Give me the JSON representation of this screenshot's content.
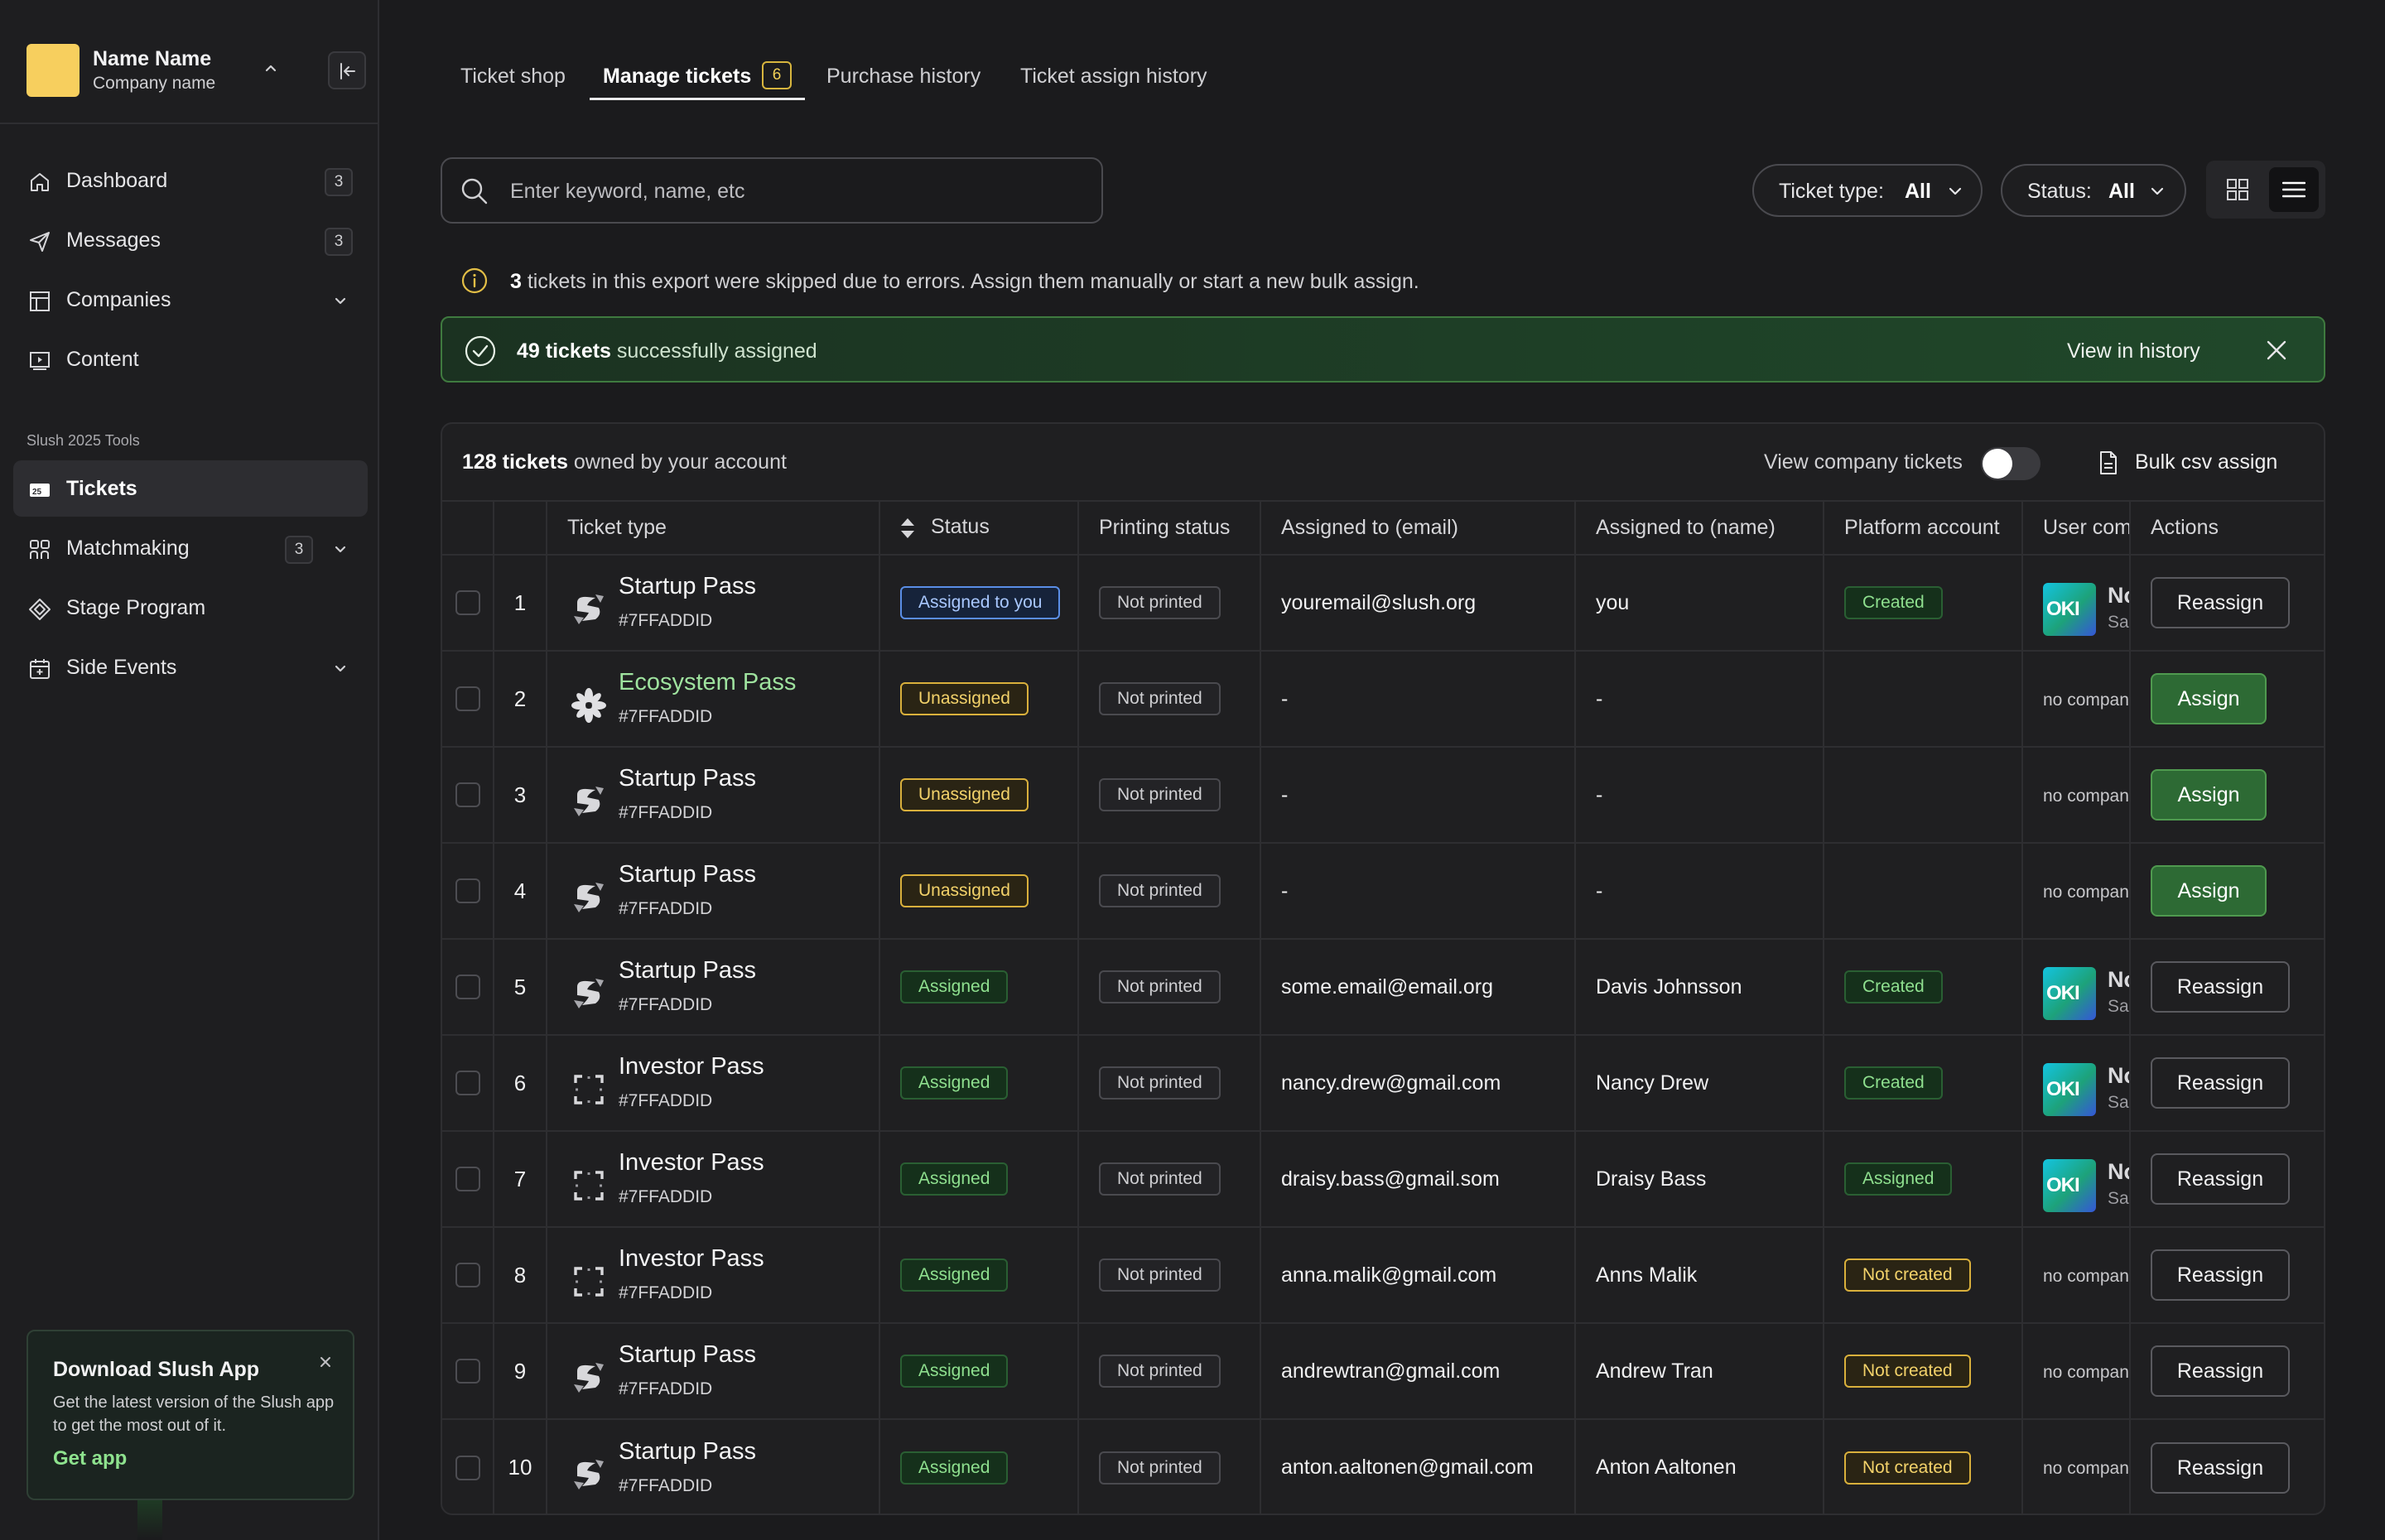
{
  "profile": {
    "name": "Name Name",
    "company": "Company name"
  },
  "nav": [
    {
      "label": "Dashboard",
      "count": "3",
      "icon": "home-icon"
    },
    {
      "label": "Messages",
      "count": "3",
      "icon": "paper-plane-icon"
    },
    {
      "label": "Companies",
      "icon": "building-icon",
      "expandable": true
    },
    {
      "label": "Content",
      "icon": "play-screen-icon"
    }
  ],
  "tools_section": "Slush 2025 Tools",
  "tools": [
    {
      "label": "Tickets",
      "icon": "ticket-icon",
      "active": true
    },
    {
      "label": "Matchmaking",
      "count": "3",
      "icon": "people-icon",
      "expandable": true
    },
    {
      "label": "Stage Program",
      "icon": "diamond-icon"
    },
    {
      "label": "Side Events",
      "icon": "calendar-icon",
      "expandable": true
    }
  ],
  "promo": {
    "title": "Download Slush App",
    "text": "Get the latest version of the Slush app to get the most out of it.",
    "link": "Get app"
  },
  "tabs": [
    {
      "label": "Ticket shop"
    },
    {
      "label": "Manage tickets",
      "badge": "6",
      "active": true
    },
    {
      "label": "Purchase history"
    },
    {
      "label": "Ticket assign history"
    }
  ],
  "search": {
    "placeholder": "Enter keyword, name, etc",
    "value": ""
  },
  "filters": {
    "ticket_type": {
      "label": "Ticket type:",
      "value": "All"
    },
    "status": {
      "label": "Status:",
      "value": "All"
    }
  },
  "notice": {
    "count": "3",
    "text": "tickets in this export were skipped due to errors. Assign them manually or start a new bulk assign."
  },
  "success": {
    "count_text": "49 tickets",
    "text": "successfully assigned",
    "link": "View in history"
  },
  "panel": {
    "count_text": "128 tickets",
    "owned_text": "owned by your account",
    "toggle_label": "View company tickets",
    "bulk_label": "Bulk csv assign"
  },
  "columns": [
    "Ticket type",
    "Status",
    "Printing status",
    "Assigned to (email)",
    "Assigned to (name)",
    "Platform account",
    "User com",
    "Actions"
  ],
  "company": {
    "logo_text": "OKI",
    "name_initial": "No",
    "sub_initial": "Sa"
  },
  "rows": [
    {
      "num": "1",
      "type": "Startup Pass",
      "logo": "startup",
      "code": "#7FFADDID",
      "status": "Assigned to you",
      "status_kind": "blue",
      "printing": "Not printed",
      "email": "youremail@slush.org",
      "name": "you",
      "platform": "Created",
      "platform_kind": "green",
      "user_company": "logo",
      "action": "Reassign"
    },
    {
      "num": "2",
      "type": "Ecosystem Pass",
      "logo": "ecosystem",
      "code": "#7FFADDID",
      "status": "Unassigned",
      "status_kind": "yellow",
      "printing": "Not printed",
      "email": "-",
      "name": "-",
      "platform": "",
      "platform_kind": "",
      "user_company": "no company",
      "action": "Assign"
    },
    {
      "num": "3",
      "type": "Startup Pass",
      "logo": "startup",
      "code": "#7FFADDID",
      "status": "Unassigned",
      "status_kind": "yellow",
      "printing": "Not printed",
      "email": "-",
      "name": "-",
      "platform": "",
      "platform_kind": "",
      "user_company": "no company",
      "action": "Assign"
    },
    {
      "num": "4",
      "type": "Startup Pass",
      "logo": "startup",
      "code": "#7FFADDID",
      "status": "Unassigned",
      "status_kind": "yellow",
      "printing": "Not printed",
      "email": "-",
      "name": "-",
      "platform": "",
      "platform_kind": "",
      "user_company": "no company",
      "action": "Assign"
    },
    {
      "num": "5",
      "type": "Startup Pass",
      "logo": "startup",
      "code": "#7FFADDID",
      "status": "Assigned",
      "status_kind": "green",
      "printing": "Not printed",
      "email": "some.email@email.org",
      "name": "Davis Johnsson",
      "platform": "Created",
      "platform_kind": "green",
      "user_company": "logo",
      "action": "Reassign"
    },
    {
      "num": "6",
      "type": "Investor Pass",
      "logo": "investor",
      "code": "#7FFADDID",
      "status": "Assigned",
      "status_kind": "green",
      "printing": "Not printed",
      "email": "nancy.drew@gmail.com",
      "name": "Nancy Drew",
      "platform": "Created",
      "platform_kind": "green",
      "user_company": "logo",
      "action": "Reassign"
    },
    {
      "num": "7",
      "type": "Investor Pass",
      "logo": "investor",
      "code": "#7FFADDID",
      "status": "Assigned",
      "status_kind": "green",
      "printing": "Not printed",
      "email": "draisy.bass@gmail.som",
      "name": "Draisy Bass",
      "platform": "Assigned",
      "platform_kind": "green",
      "user_company": "logo",
      "action": "Reassign"
    },
    {
      "num": "8",
      "type": "Investor Pass",
      "logo": "investor",
      "code": "#7FFADDID",
      "status": "Assigned",
      "status_kind": "green",
      "printing": "Not printed",
      "email": "anna.malik@gmail.com",
      "name": "Anns Malik",
      "platform": "Not created",
      "platform_kind": "yellow",
      "user_company": "no company",
      "action": "Reassign"
    },
    {
      "num": "9",
      "type": "Startup Pass",
      "logo": "startup",
      "code": "#7FFADDID",
      "status": "Assigned",
      "status_kind": "green",
      "printing": "Not printed",
      "email": "andrewtran@gmail.com",
      "name": "Andrew Tran",
      "platform": "Not created",
      "platform_kind": "yellow",
      "user_company": "no company",
      "action": "Reassign"
    },
    {
      "num": "10",
      "type": "Startup Pass",
      "logo": "startup",
      "code": "#7FFADDID",
      "status": "Assigned",
      "status_kind": "green",
      "printing": "Not printed",
      "email": "anton.aaltonen@gmail.com",
      "name": "Anton Aaltonen",
      "platform": "Not created",
      "platform_kind": "yellow",
      "user_company": "no company",
      "action": "Reassign"
    }
  ]
}
